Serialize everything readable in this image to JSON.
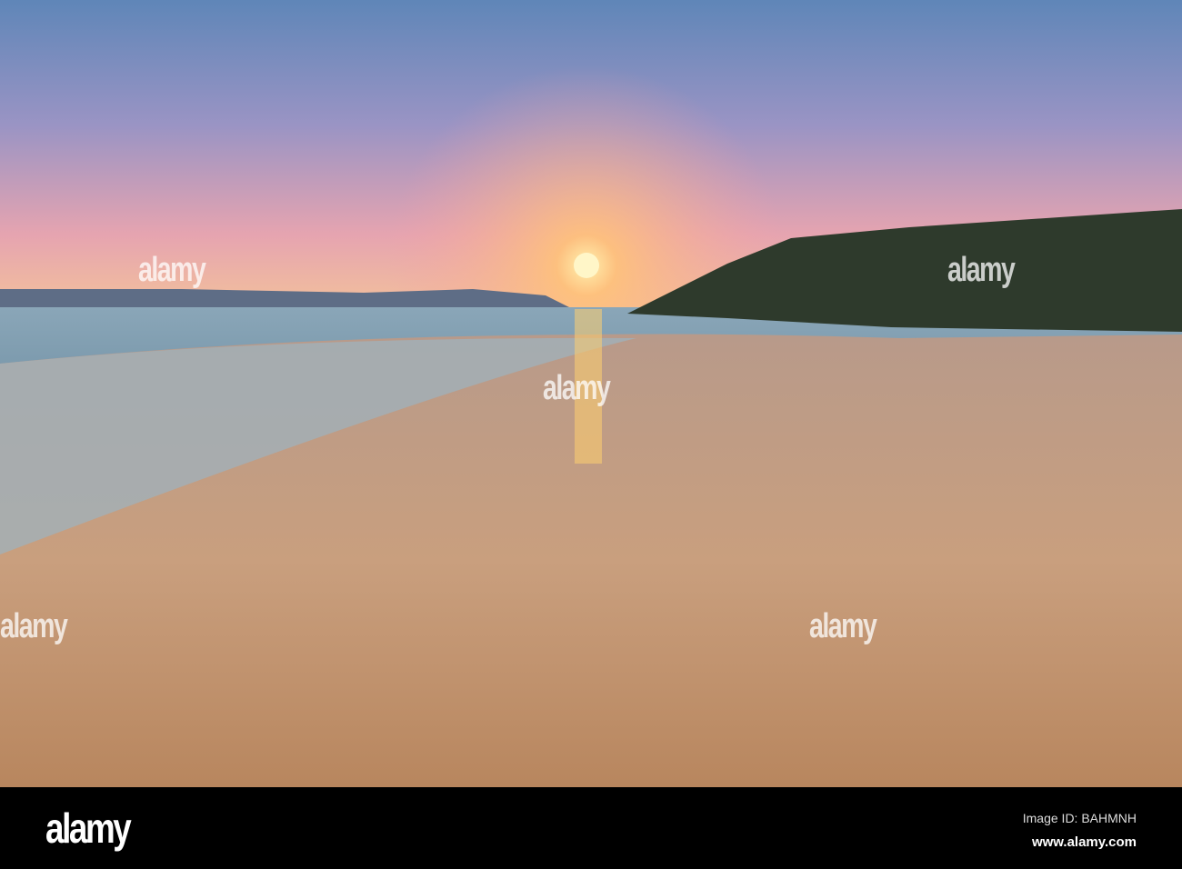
{
  "watermark": {
    "text": "alamy"
  },
  "footer": {
    "logo": "alamy",
    "image_id": "Image ID: BAHMNH",
    "url": "www.alamy.com"
  }
}
